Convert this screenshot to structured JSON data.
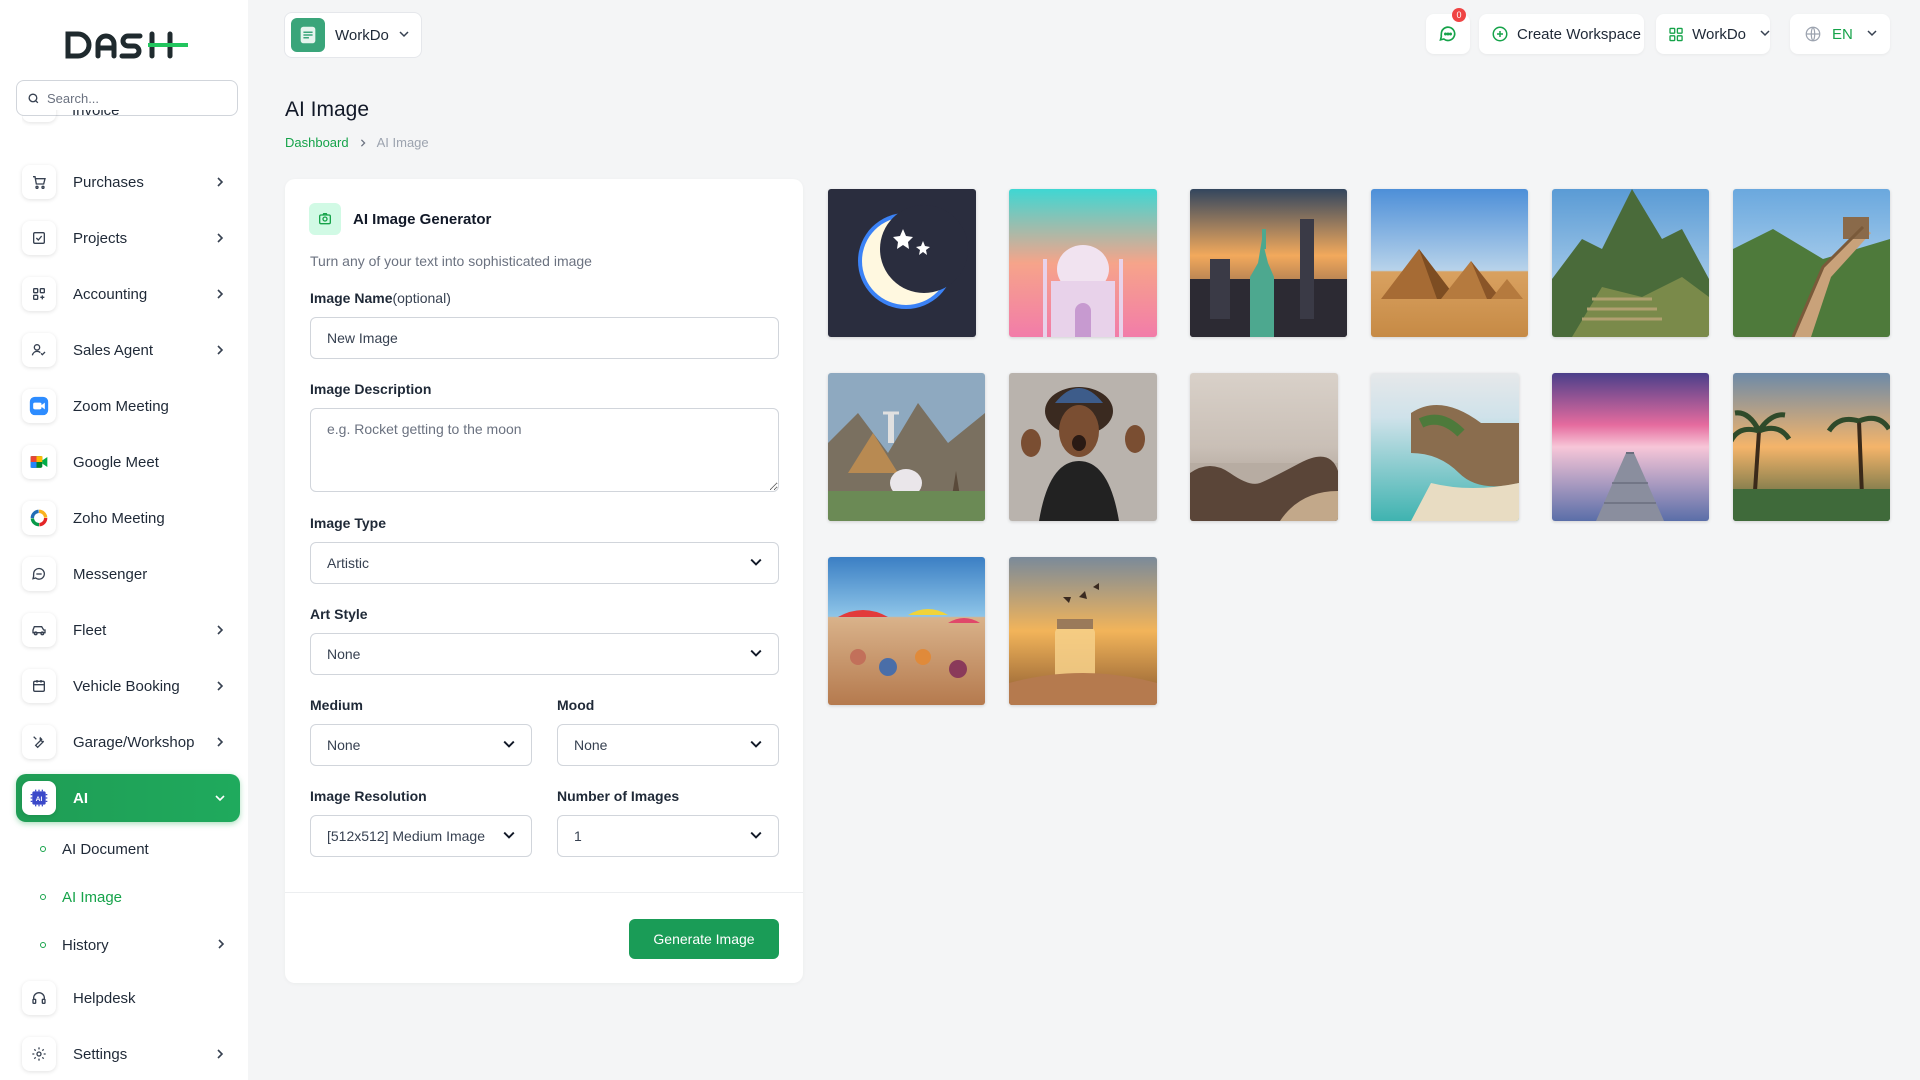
{
  "brand": {
    "logo_text": "DASH"
  },
  "search": {
    "placeholder": "Search..."
  },
  "sidebar": {
    "partial_item": "Invoice",
    "items": [
      {
        "label": "Purchases",
        "icon": "cart-icon",
        "has_children": true
      },
      {
        "label": "Projects",
        "icon": "checkbox-icon",
        "has_children": true
      },
      {
        "label": "Accounting",
        "icon": "grid-icon",
        "has_children": true
      },
      {
        "label": "Sales Agent",
        "icon": "user-check-icon",
        "has_children": true
      },
      {
        "label": "Zoom Meeting",
        "icon": "zoom-icon",
        "has_children": false
      },
      {
        "label": "Google Meet",
        "icon": "google-meet-icon",
        "has_children": false
      },
      {
        "label": "Zoho Meeting",
        "icon": "zoho-icon",
        "has_children": false
      },
      {
        "label": "Messenger",
        "icon": "message-icon",
        "has_children": false
      },
      {
        "label": "Fleet",
        "icon": "car-icon",
        "has_children": true
      },
      {
        "label": "Vehicle Booking",
        "icon": "calendar-icon",
        "has_children": true
      },
      {
        "label": "Garage/Workshop",
        "icon": "wrench-icon",
        "has_children": true
      },
      {
        "label": "AI",
        "icon": "ai-chip-icon",
        "has_children": true,
        "active": true
      },
      {
        "label": "Helpdesk",
        "icon": "headset-icon",
        "has_children": false
      },
      {
        "label": "Settings",
        "icon": "gear-icon",
        "has_children": true
      }
    ],
    "sub_items": [
      {
        "label": "AI Document"
      },
      {
        "label": "AI Image",
        "active": true
      },
      {
        "label": "History",
        "has_children": true
      }
    ]
  },
  "header": {
    "workspace_name": "WorkDo",
    "notification_count": "0",
    "create_workspace": "Create Workspace",
    "workspace_menu": "WorkDo",
    "language": "EN"
  },
  "page": {
    "title": "AI Image",
    "breadcrumb": [
      "Dashboard",
      "AI Image"
    ]
  },
  "form": {
    "title": "AI Image Generator",
    "subtitle": "Turn any of your text into sophisticated image",
    "image_name_label": "Image Name",
    "image_name_optional": "(optional)",
    "image_name_value": "New Image",
    "description_label": "Image Description",
    "description_placeholder": "e.g. Rocket getting to the moon",
    "type_label": "Image Type",
    "type_value": "Artistic",
    "art_style_label": "Art Style",
    "art_style_value": "None",
    "medium_label": "Medium",
    "medium_value": "None",
    "mood_label": "Mood",
    "mood_value": "None",
    "resolution_label": "Image Resolution",
    "resolution_value": "[512x512] Medium Image",
    "count_label": "Number of Images",
    "count_value": "1",
    "submit_label": "Generate Image"
  },
  "gallery": [
    {
      "name": "crescent-moon-image"
    },
    {
      "name": "taj-mahal-image"
    },
    {
      "name": "statue-of-liberty-image"
    },
    {
      "name": "pyramids-image"
    },
    {
      "name": "machu-picchu-image"
    },
    {
      "name": "great-wall-image"
    },
    {
      "name": "world-wonders-collage-image"
    },
    {
      "name": "excited-woman-image"
    },
    {
      "name": "rocky-shore-image"
    },
    {
      "name": "tropical-coast-image"
    },
    {
      "name": "pier-sunset-image"
    },
    {
      "name": "palm-beach-sunset-image"
    },
    {
      "name": "crowded-beach-image"
    },
    {
      "name": "butterfly-jar-image"
    }
  ],
  "colors": {
    "accent": "#16a34a",
    "badge": "#ef4444"
  }
}
